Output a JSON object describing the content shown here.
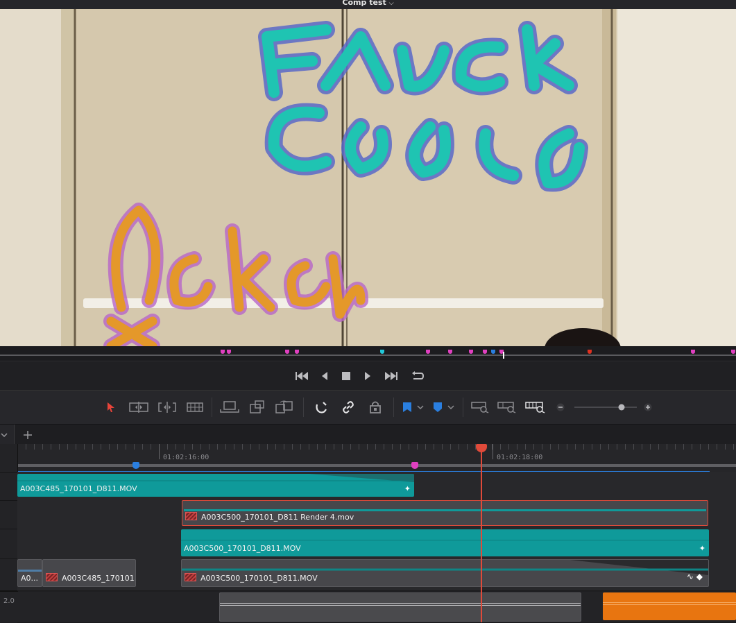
{
  "window": {
    "title": "Comp test"
  },
  "timeline": {
    "timecodes": [
      "01:02:16:00",
      "01:02:18:00"
    ],
    "audio_track_label": "2.0",
    "clips": {
      "v4_clip": "A003C485_170101_D811.MOV",
      "v3_clip": "A003C500_170101_D811 Render 4.mov",
      "v2_clip": "A003C500_170101_D811.MOV",
      "v1_clip_a": "A0...",
      "v1_clip_b": "A003C485_170101...",
      "v1_clip_c": "A003C500_170101_D811.MOV"
    }
  },
  "colors": {
    "accent": "#0f9a9a",
    "playhead": "#e04a3a",
    "marker_pink": "#e040c0",
    "marker_blue": "#2a7fe0",
    "marker_cyan": "#22c8d8",
    "marker_red": "#e03020",
    "audio_orange": "#e87510"
  }
}
